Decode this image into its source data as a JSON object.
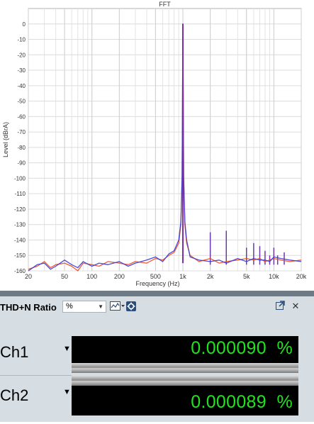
{
  "chart_data": {
    "type": "line",
    "title": "FFT",
    "xlabel": "Frequency (Hz)",
    "ylabel": "Level (dBrA)",
    "x_scale": "log",
    "xlim": [
      20,
      20000
    ],
    "ylim": [
      -160,
      10
    ],
    "x_ticks": [
      20,
      50,
      100,
      200,
      500,
      1000,
      2000,
      5000,
      10000,
      20000
    ],
    "x_tick_labels": [
      "20",
      "50",
      "100",
      "200",
      "500",
      "1k",
      "2k",
      "5k",
      "10k",
      "20k"
    ],
    "y_ticks": [
      0,
      -10,
      -20,
      -30,
      -40,
      -50,
      -60,
      -70,
      -80,
      -90,
      -100,
      -110,
      -120,
      -130,
      -140,
      -150,
      -160
    ],
    "y_tick_labels": [
      "0",
      "-10",
      "-20",
      "-30",
      "-40",
      "-50",
      "-60",
      "-70",
      "-80",
      "-90",
      "-100",
      "-110",
      "-120",
      "-130",
      "-140",
      "-150",
      "-160"
    ],
    "grid": true,
    "series": [
      {
        "color": "#f04a1e",
        "x": [
          20,
          25,
          30,
          35,
          40,
          50,
          60,
          70,
          80,
          100,
          120,
          150,
          200,
          250,
          300,
          400,
          500,
          600,
          700,
          800,
          900,
          950,
          980,
          1000,
          1020,
          1050,
          1100,
          1200,
          1500,
          2000,
          2500,
          3000,
          4000,
          5000,
          6000,
          7000,
          8000,
          9000,
          10000,
          12000,
          15000,
          20000
        ],
        "y": [
          -159,
          -157,
          -154,
          -158,
          -156,
          -155,
          -157,
          -160,
          -155,
          -156,
          -157,
          -154,
          -155,
          -156,
          -154,
          -155,
          -152,
          -153,
          -150,
          -148,
          -142,
          -130,
          -100,
          0,
          -100,
          -130,
          -142,
          -150,
          -154,
          -152,
          -155,
          -154,
          -153,
          -152,
          -153,
          -152,
          -154,
          -153,
          -152,
          -153,
          -154,
          -153
        ]
      },
      {
        "color": "#3a3ad6",
        "x": [
          20,
          25,
          30,
          35,
          40,
          50,
          60,
          70,
          80,
          100,
          120,
          150,
          200,
          250,
          300,
          400,
          500,
          600,
          700,
          800,
          900,
          950,
          980,
          1000,
          1020,
          1050,
          1100,
          1200,
          1500,
          2000,
          2500,
          3000,
          4000,
          5000,
          6000,
          7000,
          8000,
          9000,
          10000,
          12000,
          15000,
          20000
        ],
        "y": [
          -160,
          -156,
          -155,
          -159,
          -157,
          -153,
          -156,
          -158,
          -154,
          -157,
          -155,
          -156,
          -154,
          -157,
          -155,
          -153,
          -151,
          -154,
          -149,
          -147,
          -140,
          -128,
          -98,
          0,
          -98,
          -128,
          -140,
          -151,
          -153,
          -154,
          -153,
          -155,
          -152,
          -154,
          -152,
          -153,
          -153,
          -154,
          -151,
          -152,
          -153,
          -154
        ]
      }
    ],
    "harmonics": [
      {
        "x": 2000,
        "y": -135
      },
      {
        "x": 3000,
        "y": -134
      },
      {
        "x": 5000,
        "y": -145
      },
      {
        "x": 6000,
        "y": -142
      },
      {
        "x": 7000,
        "y": -144
      },
      {
        "x": 8000,
        "y": -147
      },
      {
        "x": 9000,
        "y": -150
      },
      {
        "x": 10000,
        "y": -145
      },
      {
        "x": 11000,
        "y": -150
      },
      {
        "x": 13000,
        "y": -148
      }
    ]
  },
  "meter": {
    "title": "THD+N Ratio",
    "unit": "%",
    "channels": [
      {
        "label": "Ch1",
        "value": "0.000090",
        "unit": "%"
      },
      {
        "label": "Ch2",
        "value": "0.000089",
        "unit": "%"
      }
    ]
  },
  "icons": {
    "dropdown_arrow": "chevron-down-icon",
    "graph_menu": "graph-icon",
    "settings": "gear-icon",
    "popout": "popout-icon",
    "close": "close-icon"
  }
}
